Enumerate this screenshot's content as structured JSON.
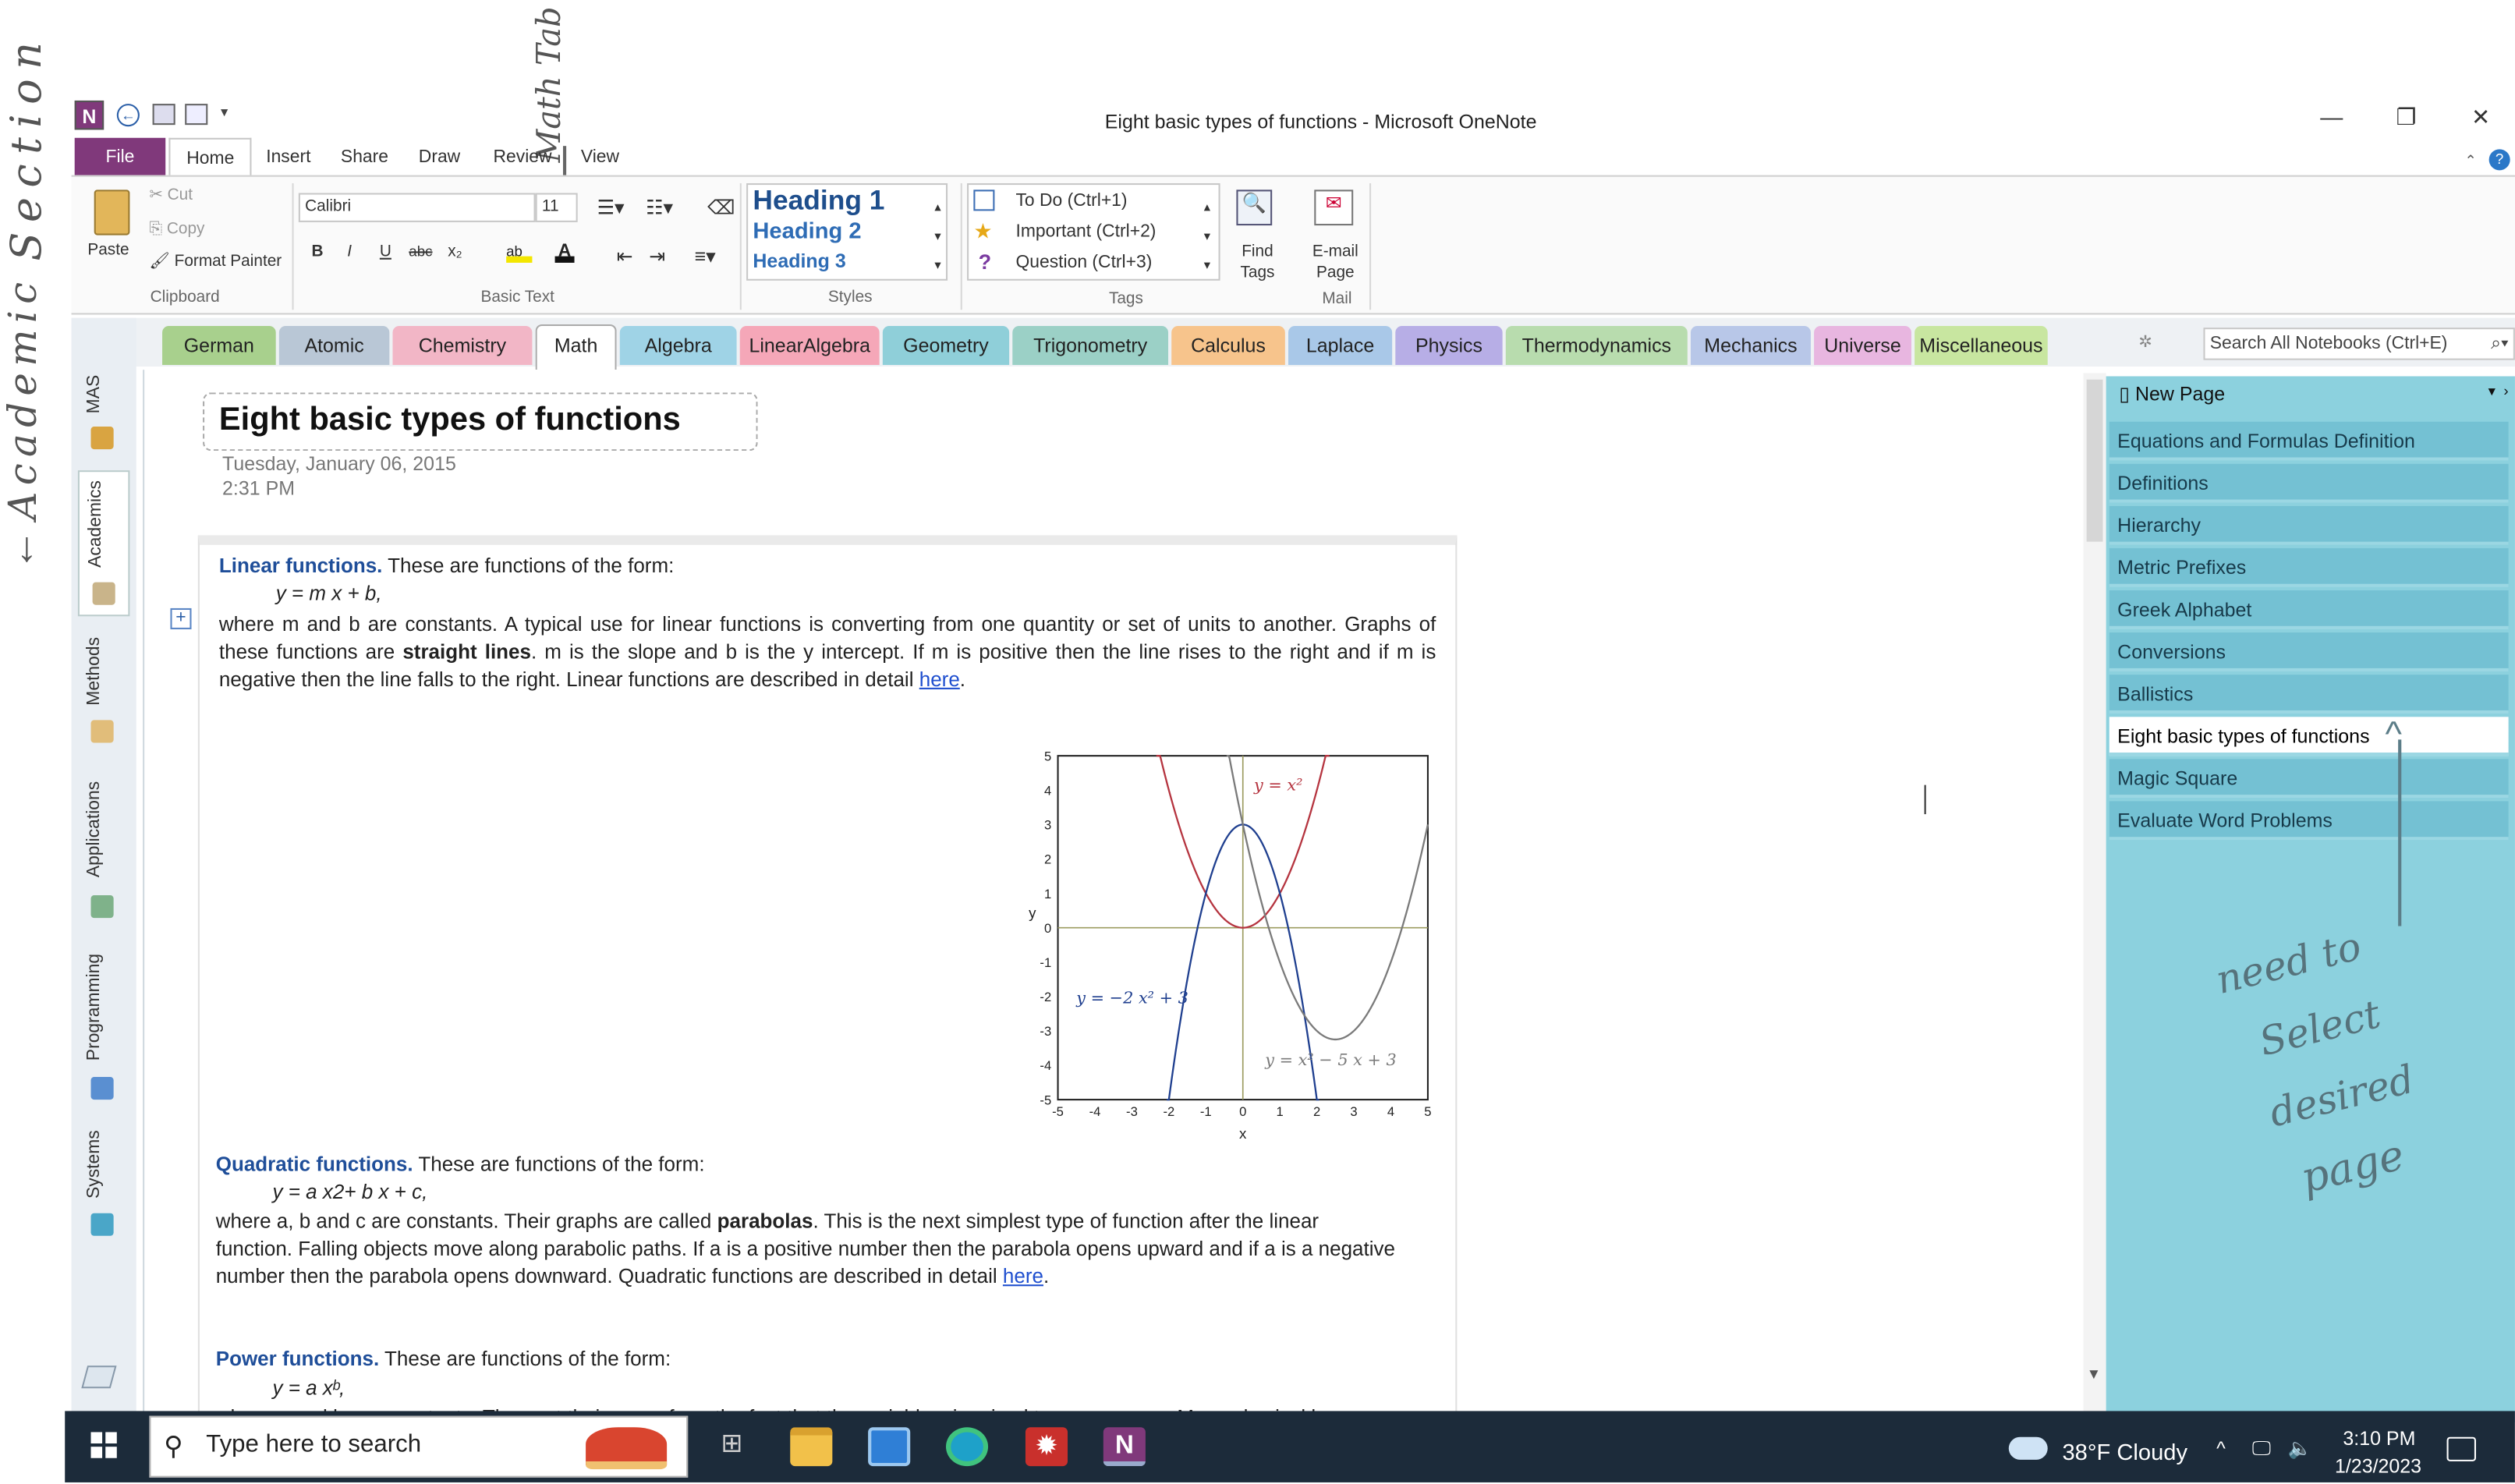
{
  "window": {
    "title": "Eight basic types of functions - Microsoft OneNote",
    "minimize": "—",
    "maximize": "❐",
    "close": "✕"
  },
  "ribbon_tabs": [
    "File",
    "Home",
    "Insert",
    "Share",
    "Draw",
    "Review",
    "View"
  ],
  "ribbon": {
    "paste": "Paste",
    "cut": "Cut",
    "copy": "Copy",
    "format_painter": "Format Painter",
    "clipboard": "Clipboard",
    "font": "Calibri",
    "size": "11",
    "bold": "B",
    "italic": "I",
    "underline": "U",
    "strike": "abc",
    "subscript": "x₂",
    "basic_text": "Basic Text",
    "heading1": "Heading 1",
    "heading2": "Heading 2",
    "heading3": "Heading 3",
    "styles": "Styles",
    "todo": "To Do (Ctrl+1)",
    "important": "Important (Ctrl+2)",
    "question": "Question (Ctrl+3)",
    "tags": "Tags",
    "find_tags_1": "Find",
    "find_tags_2": "Tags",
    "email_1": "E-mail",
    "email_2": "Page",
    "mail": "Mail"
  },
  "section_tabs": [
    {
      "label": "German",
      "color": "#a8d08d"
    },
    {
      "label": "Atomic",
      "color": "#b9c7d6"
    },
    {
      "label": "Chemistry",
      "color": "#f2b6c6"
    },
    {
      "label": "Math",
      "color": "#ffffff"
    },
    {
      "label": "Algebra",
      "color": "#9fd3e6"
    },
    {
      "label": "LinearAlgebra",
      "color": "#f5a7b8"
    },
    {
      "label": "Geometry",
      "color": "#8fcfd9"
    },
    {
      "label": "Trigonometry",
      "color": "#9bd0c6"
    },
    {
      "label": "Calculus",
      "color": "#f7c48c"
    },
    {
      "label": "Laplace",
      "color": "#a9c8e8"
    },
    {
      "label": "Physics",
      "color": "#b7aee6"
    },
    {
      "label": "Thermodynamics",
      "color": "#b8dcae"
    },
    {
      "label": "Mechanics",
      "color": "#b8c7e8"
    },
    {
      "label": "Universe",
      "color": "#e8b6e0"
    },
    {
      "label": "Miscellaneous",
      "color": "#c8e6a0"
    }
  ],
  "search_notebooks": "Search All Notebooks (Ctrl+E)",
  "notebooks": [
    "MAS",
    "Academics",
    "Methods",
    "Applications",
    "Programming",
    "Systems"
  ],
  "page": {
    "title": "Eight basic types of functions",
    "date": "Tuesday, January 06, 2015",
    "time": "2:31 PM",
    "linear_head": "Linear functions.",
    "linear_intro": "These are functions of the form:",
    "linear_formula": "y = m x + b,",
    "linear_body_1": "where m and b are constants. A typical use for linear functions is converting from one quantity or set of units to another. Graphs of these functions are",
    "linear_bold": "straight lines",
    "linear_body_2": ". m is the slope and b is the y intercept. If m is positive then the line rises to the right and if m is negative then the line falls to the right. Linear functions are described in detail",
    "here": "here",
    "quad_head": "Quadratic functions.",
    "quad_intro": "These are functions of the form:",
    "quad_formula": "y = a x2+ b x + c,",
    "quad_body_1": "where a, b and c are constants. Their graphs are called",
    "quad_bold": "parabolas",
    "quad_body_2": ". This is the next simplest type of function after the linear function. Falling objects move along parabolic paths. If a is a positive number then the parabola opens upward and if a is a negative number then the parabola opens downward. Quadratic functions are described in detail",
    "power_head": "Power functions.",
    "power_intro": "These are functions of the form:",
    "power_formula": "y = a xᵇ,",
    "power_body": "where a and b are constants. They get their name from the fact that the variable x is raised to some power. Many physical laws"
  },
  "chart_data": {
    "type": "line",
    "xlabel": "x",
    "ylabel": "y",
    "xlim": [
      -5,
      5
    ],
    "ylim": [
      -5,
      5
    ],
    "xticks": [
      "-5",
      "-4",
      "-3",
      "-2",
      "-1",
      "0",
      "1",
      "2",
      "3",
      "4",
      "5"
    ],
    "yticks": [
      "5",
      "4",
      "3",
      "2",
      "1",
      "0",
      "-1",
      "-2",
      "-3",
      "-4",
      "-5"
    ],
    "series": [
      {
        "name": "y = x²",
        "color": "#b5343f"
      },
      {
        "name": "y = −2 x² + 3",
        "color": "#1f3f8f"
      },
      {
        "name": "y = x² − 5 x + 3",
        "color": "#7a7a7a"
      }
    ]
  },
  "pages_pane": {
    "new_page": "New Page",
    "pages": [
      "Equations and Formulas Definition",
      "Definitions",
      "Hierarchy",
      "Metric Prefixes",
      "Greek Alphabet",
      "Conversions",
      "Ballistics",
      "Eight basic types of functions",
      "Magic Square",
      "Evaluate Word Problems"
    ]
  },
  "taskbar": {
    "search": "Type here to search",
    "weather": "38°F  Cloudy",
    "time": "3:10 PM",
    "date": "1/23/2023"
  },
  "handwriting": {
    "section": "Section",
    "academic": "Academic",
    "math_tab": "Math Tab",
    "note_1": "need to",
    "note_2": "Select",
    "note_3": "desired",
    "note_4": "page"
  }
}
